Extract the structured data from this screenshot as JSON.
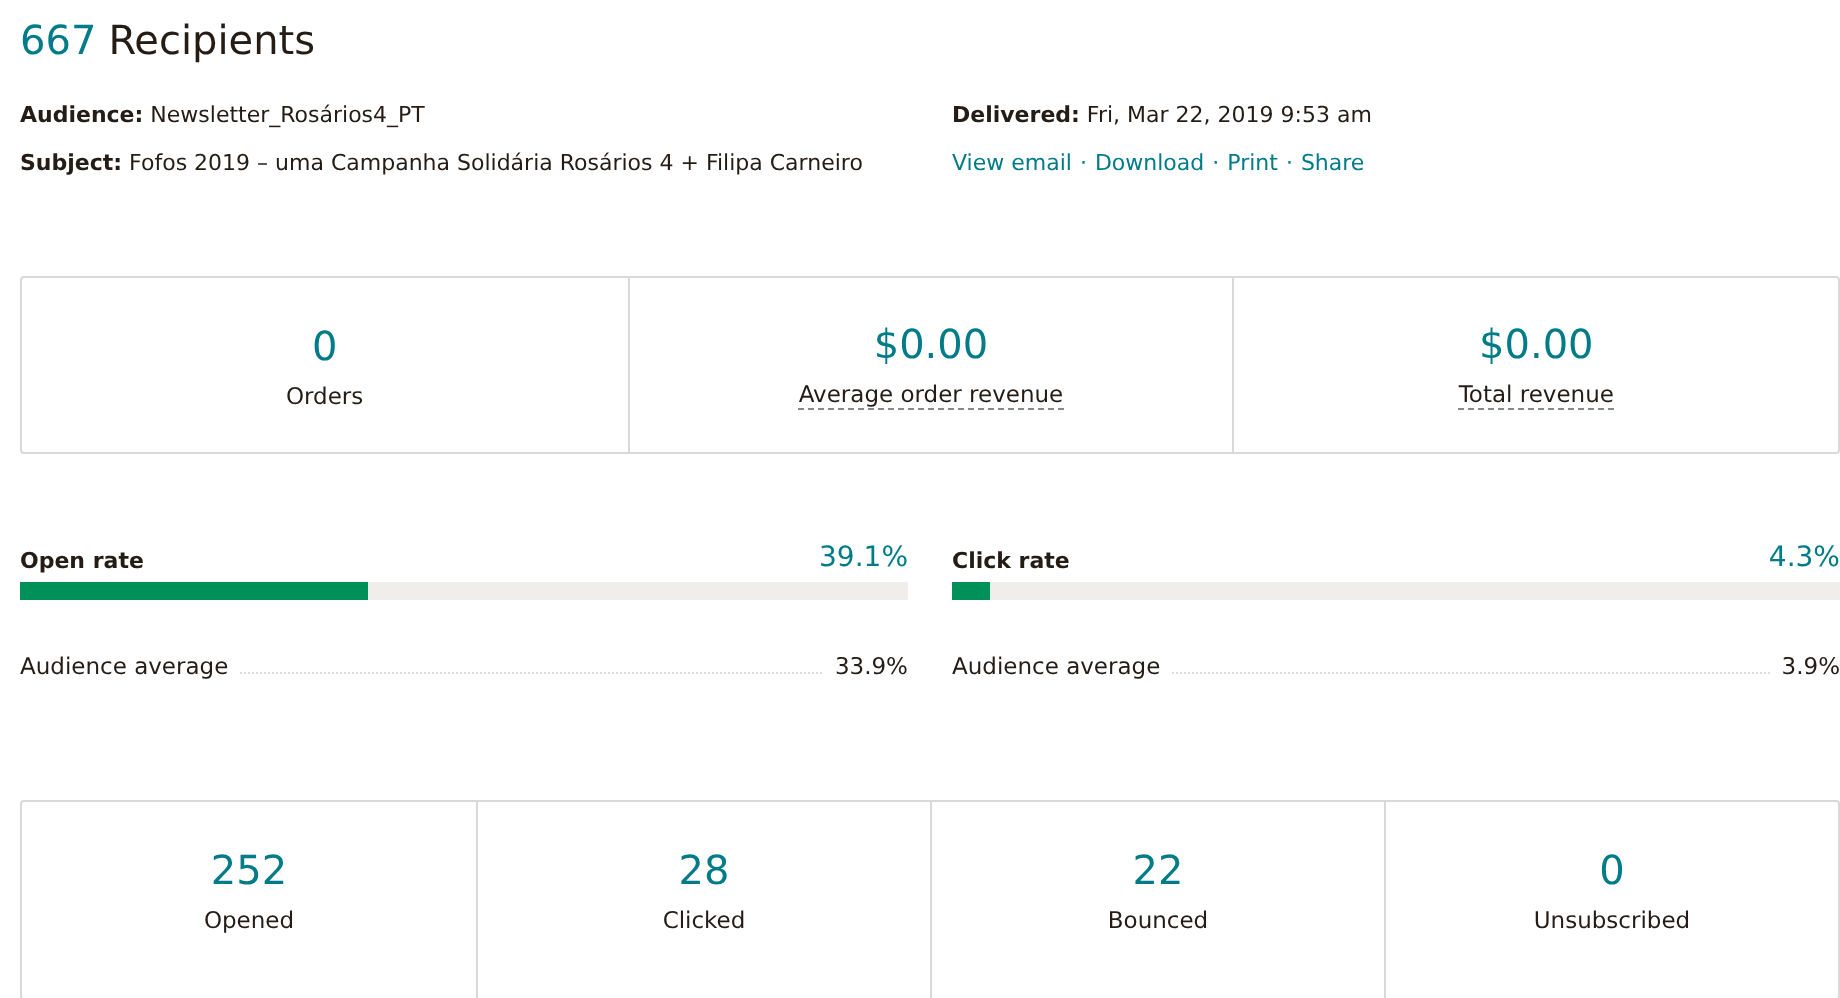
{
  "header": {
    "count": "667",
    "title": "Recipients"
  },
  "details_left": [
    {
      "label": "Audience:",
      "value": "Newsletter_Rosários4_PT"
    },
    {
      "label": "Subject:",
      "value": "Fofos 2019 – uma Campanha Solidária Rosários 4 + Filipa Carneiro"
    }
  ],
  "delivered": {
    "label": "Delivered:",
    "value": "Fri, Mar 22, 2019 9:53 am"
  },
  "links": [
    "View email",
    "Download",
    "Print",
    "Share"
  ],
  "link_separator": "·",
  "revenue_stats": [
    {
      "value": "0",
      "label": "Orders",
      "kind": "plain"
    },
    {
      "value": "$0.00",
      "label": "Average order revenue",
      "kind": "hint"
    },
    {
      "value": "$0.00",
      "label": "Total revenue",
      "kind": "hint"
    }
  ],
  "rates": [
    {
      "label": "Open rate",
      "reading": "39.1%",
      "level": 0.391,
      "average_label": "Audience average",
      "average": "33.9%"
    },
    {
      "label": "Click rate",
      "reading": "4.3%",
      "level": 0.043,
      "average_label": "Audience average",
      "average": "3.9%"
    }
  ],
  "engagement_stats": [
    {
      "value": "252",
      "label": "Opened"
    },
    {
      "value": "28",
      "label": "Clicked"
    },
    {
      "value": "22",
      "label": "Bounced"
    },
    {
      "value": "0",
      "label": "Unsubscribed"
    }
  ]
}
